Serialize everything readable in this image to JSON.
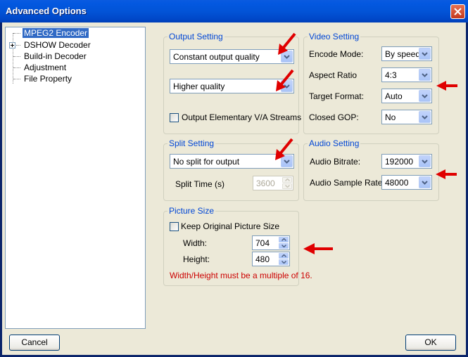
{
  "window": {
    "title": "Advanced Options"
  },
  "tree": {
    "items": [
      {
        "label": "MPEG2 Encoder",
        "selected": true
      },
      {
        "label": "DSHOW Decoder",
        "expandable": true
      },
      {
        "label": "Build-in Decoder"
      },
      {
        "label": "Adjustment"
      },
      {
        "label": "File Property"
      }
    ]
  },
  "output_setting": {
    "legend": "Output Setting",
    "mode": "Constant output quality",
    "quality": "Higher quality",
    "elementary_label": "Output Elementary V/A Streams",
    "elementary_checked": false
  },
  "video_setting": {
    "legend": "Video Setting",
    "encode_mode_label": "Encode Mode:",
    "encode_mode": "By speed",
    "aspect_ratio_label": "Aspect Ratio",
    "aspect_ratio": "4:3",
    "target_format_label": "Target Format:",
    "target_format": "Auto",
    "closed_gop_label": "Closed GOP:",
    "closed_gop": "No"
  },
  "split_setting": {
    "legend": "Split Setting",
    "mode": "No split for output",
    "split_time_label": "Split Time (s)",
    "split_time": "3600"
  },
  "audio_setting": {
    "legend": "Audio Setting",
    "bitrate_label": "Audio Bitrate:",
    "bitrate": "192000",
    "sample_rate_label": "Audio Sample Rate:",
    "sample_rate": "48000"
  },
  "picture_size": {
    "legend": "Picture Size",
    "keep_label": "Keep Original Picture Size",
    "keep_checked": false,
    "width_label": "Width:",
    "width": "704",
    "height_label": "Height:",
    "height": "480",
    "warning": "Width/Height must be a multiple of 16."
  },
  "buttons": {
    "cancel": "Cancel",
    "ok": "OK"
  },
  "colors": {
    "title_bar": "#0054e3",
    "legend_text": "#0046d5",
    "warning_text": "#cc0000",
    "annotation_arrow": "#e00000"
  },
  "icons": {
    "close": "close-icon",
    "dropdown": "chevron-down-icon",
    "annotation": "red-arrow-icon"
  }
}
